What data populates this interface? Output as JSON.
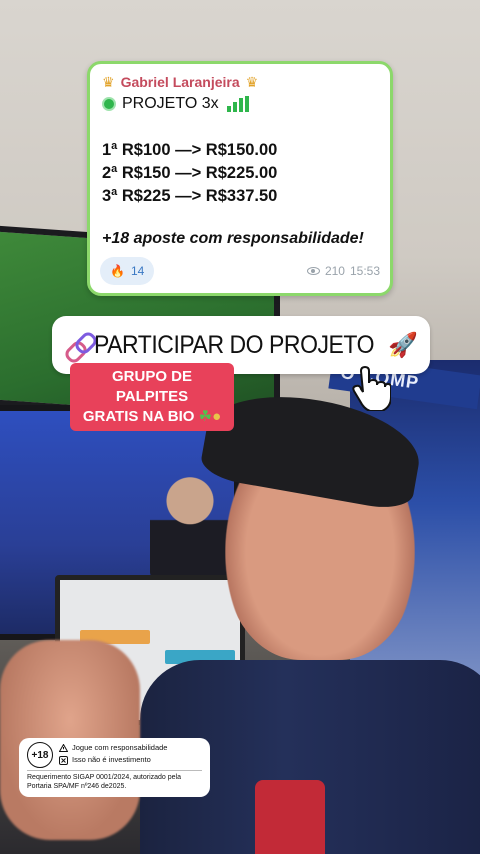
{
  "telegram_post": {
    "sender": "Gabriel Laranjeira",
    "title": "PROJETO 3x",
    "lines": [
      "1ª R$100 —> R$150.00",
      "2ª R$150 —> R$225.00",
      "3ª R$225 —> R$337.50"
    ],
    "footer": "+18 aposte com responsabilidade!",
    "reaction_count": "14",
    "views": "210",
    "time": "15:53"
  },
  "cta": {
    "label": "PARTICIPAR DO PROJETO"
  },
  "promo_tag": {
    "line1": "GRUPO DE PALPITES",
    "line2": "GRATIS NA BIO"
  },
  "background": {
    "poster_text": "O COMP"
  },
  "disclaimer": {
    "age": "+18",
    "item1": "Jogue com responsabilidade",
    "item2": "Isso não é investimento",
    "note": "Requerimento SIGAP 0001/2024, autorizado pela Portaria SPA/MF nº246 de2025."
  },
  "icons": {
    "crown": "crown-icon",
    "status": "green-circle-icon",
    "chart": "chart-increasing-icon",
    "reaction": "fire-icon",
    "views": "eye-icon",
    "link": "link-icon",
    "rocket": "rocket-icon",
    "cursor": "hand-pointer-icon",
    "clover": "four-leaf-clover-icon",
    "money": "money-bag-icon",
    "warning": "warning-icon",
    "close": "x-box-icon"
  },
  "colors": {
    "card_border": "#8cd86b",
    "sender_name": "#c44b5d",
    "promo_red": "#e8415a",
    "reaction_bg": "#e4eef9"
  }
}
